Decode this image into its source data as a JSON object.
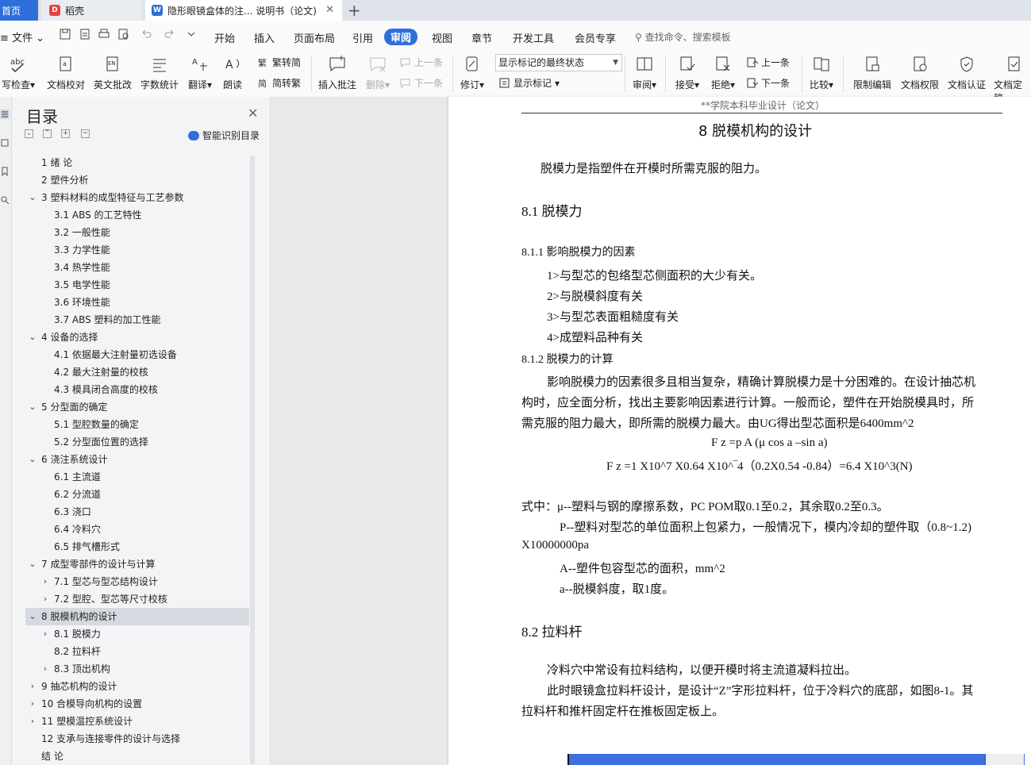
{
  "tabs": {
    "home": "首页",
    "daoke": "稻壳",
    "doc": "隐形眼镜盒体的注... 说明书（论文)"
  },
  "menu": {
    "file": "文件",
    "items": [
      "开始",
      "插入",
      "页面布局",
      "引用",
      "审阅",
      "视图",
      "章节",
      "开发工具",
      "会员专享"
    ],
    "active": "审阅",
    "search": "查找命令、搜索模板"
  },
  "ribbon": {
    "spell": "写检查",
    "doc_check": "文档校对",
    "en_review": "英文批改",
    "word_count": "字数统计",
    "translate": "翻译",
    "read_aloud": "朗读",
    "trad_to_simp": "繁转简",
    "simp_to_trad": "简转繁",
    "insert_comment": "插入批注",
    "delete": "删除",
    "prev": "上一条",
    "next": "下一条",
    "revise": "修订",
    "markup_select": "显示标记的最终状态",
    "show_markup": "显示标记",
    "review": "审阅",
    "accept": "接受",
    "reject": "拒绝",
    "prev2": "上一条",
    "next2": "下一条",
    "compare": "比较",
    "restrict": "限制编辑",
    "doc_perm": "文档权限",
    "doc_auth": "文档认证",
    "doc_final": "文档定稿"
  },
  "toc": {
    "title": "目录",
    "smart": "智能识别目录",
    "items": [
      {
        "text": "1  绪  论",
        "level": 1,
        "caret": ""
      },
      {
        "text": "2  塑件分析",
        "level": 1,
        "caret": ""
      },
      {
        "text": "3  塑料材料的成型特征与工艺参数",
        "level": 1,
        "caret": "v"
      },
      {
        "text": "3.1 ABS 的工艺特性",
        "level": 2,
        "caret": ""
      },
      {
        "text": "3.2  一般性能",
        "level": 2,
        "caret": ""
      },
      {
        "text": "3.3  力学性能",
        "level": 2,
        "caret": ""
      },
      {
        "text": "3.4  热学性能",
        "level": 2,
        "caret": ""
      },
      {
        "text": "3.5  电学性能",
        "level": 2,
        "caret": ""
      },
      {
        "text": "3.6  环境性能",
        "level": 2,
        "caret": ""
      },
      {
        "text": "3.7 ABS 塑料的加工性能",
        "level": 2,
        "caret": ""
      },
      {
        "text": "4  设备的选择",
        "level": 1,
        "caret": "v"
      },
      {
        "text": "4.1  依据最大注射量初选设备",
        "level": 2,
        "caret": ""
      },
      {
        "text": "4.2  最大注射量的校核",
        "level": 2,
        "caret": ""
      },
      {
        "text": "4.3  模具闭合高度的校核",
        "level": 2,
        "caret": ""
      },
      {
        "text": "5  分型面的确定",
        "level": 1,
        "caret": "v"
      },
      {
        "text": "5.1  型腔数量的确定",
        "level": 2,
        "caret": ""
      },
      {
        "text": "5.2  分型面位置的选择",
        "level": 2,
        "caret": ""
      },
      {
        "text": "6  浇注系统设计",
        "level": 1,
        "caret": "v"
      },
      {
        "text": "6.1  主流道",
        "level": 2,
        "caret": ""
      },
      {
        "text": "6.2  分流道",
        "level": 2,
        "caret": ""
      },
      {
        "text": "6.3  浇口",
        "level": 2,
        "caret": ""
      },
      {
        "text": "6.4  冷料穴",
        "level": 2,
        "caret": ""
      },
      {
        "text": "6.5  排气槽形式",
        "level": 2,
        "caret": ""
      },
      {
        "text": "7  成型零部件的设计与计算",
        "level": 1,
        "caret": "v"
      },
      {
        "text": "7.1  型芯与型芯结构设计",
        "level": 2,
        "caret": ">"
      },
      {
        "text": "7.2  型腔、型芯等尺寸校核",
        "level": 2,
        "caret": ">"
      },
      {
        "text": "8  脱模机构的设计",
        "level": 1,
        "caret": "v"
      },
      {
        "text": "8.1  脱模力",
        "level": 2,
        "caret": ">"
      },
      {
        "text": "8.2  拉料杆",
        "level": 2,
        "caret": ""
      },
      {
        "text": "8.3  顶出机构",
        "level": 2,
        "caret": ">"
      },
      {
        "text": "9  抽芯机构的设计",
        "level": 1,
        "caret": ">"
      },
      {
        "text": "10  合模导向机构的设置",
        "level": 1,
        "caret": ">"
      },
      {
        "text": "11  塑模温控系统设计",
        "level": 1,
        "caret": ">"
      },
      {
        "text": "12  支承与连接零件的设计与选择",
        "level": 1,
        "caret": ""
      },
      {
        "text": "结  论",
        "level": 1,
        "caret": ""
      }
    ],
    "selected_index": 26
  },
  "doc": {
    "header": "**学院本科毕业设计（论文）",
    "chapter": "8  脱模机构的设计",
    "intro": "脱模力是指塑件在开模时所需克服的阻力。",
    "s81": "8.1  脱模力",
    "s811": "8.1.1  影响脱模力的因素",
    "f1": "1>与型芯的包络型芯侧面积的大少有关。",
    "f2": "2>与脱模斜度有关",
    "f3": "3>与型芯表面粗糙度有关",
    "f4": "4>成塑料品种有关",
    "s812": "8.1.2  脱模力的计算",
    "p1": "影响脱模力的因素很多且相当复杂，精确计算脱模力是十分困难的。在设计抽芯机",
    "p2": "构时，应全面分析，找出主要影响因素进行计算。一般而论，塑件在开始脱模具时，所",
    "p3": "需克服的阻力最大，即所需的脱模力最大。由UG得出型芯面积是6400mm^2",
    "eq1": "F z =p A (μ cos a –sin a)",
    "eq2": "F z =1 X10^7 X0.64 X10^‾4（0.2X0.54 -0.84）=6.4 X10^3(N)",
    "w1": "式中：μ--塑料与钢的摩擦系数，PC POM取0.1至0.2，其余取0.2至0.3。",
    "w2": "P--塑料对型芯的单位面积上包紧力，一般情况下，模内冷却的塑件取（0.8~1.2)",
    "w3": "X10000000pa",
    "w4": "A--塑件包容型芯的面积，mm^2",
    "w5": "a--脱模斜度，取1度。",
    "s82": "8.2  拉料杆",
    "q1": "冷料穴中常设有拉料结构，以便开模时将主流道凝料拉出。",
    "q2": "此时眼镜盒拉料杆设计，是设计“Z”字形拉料杆，位于冷料穴的底部，如图8-1。其",
    "q3": "拉料杆和推杆固定杆在推板固定板上。"
  }
}
